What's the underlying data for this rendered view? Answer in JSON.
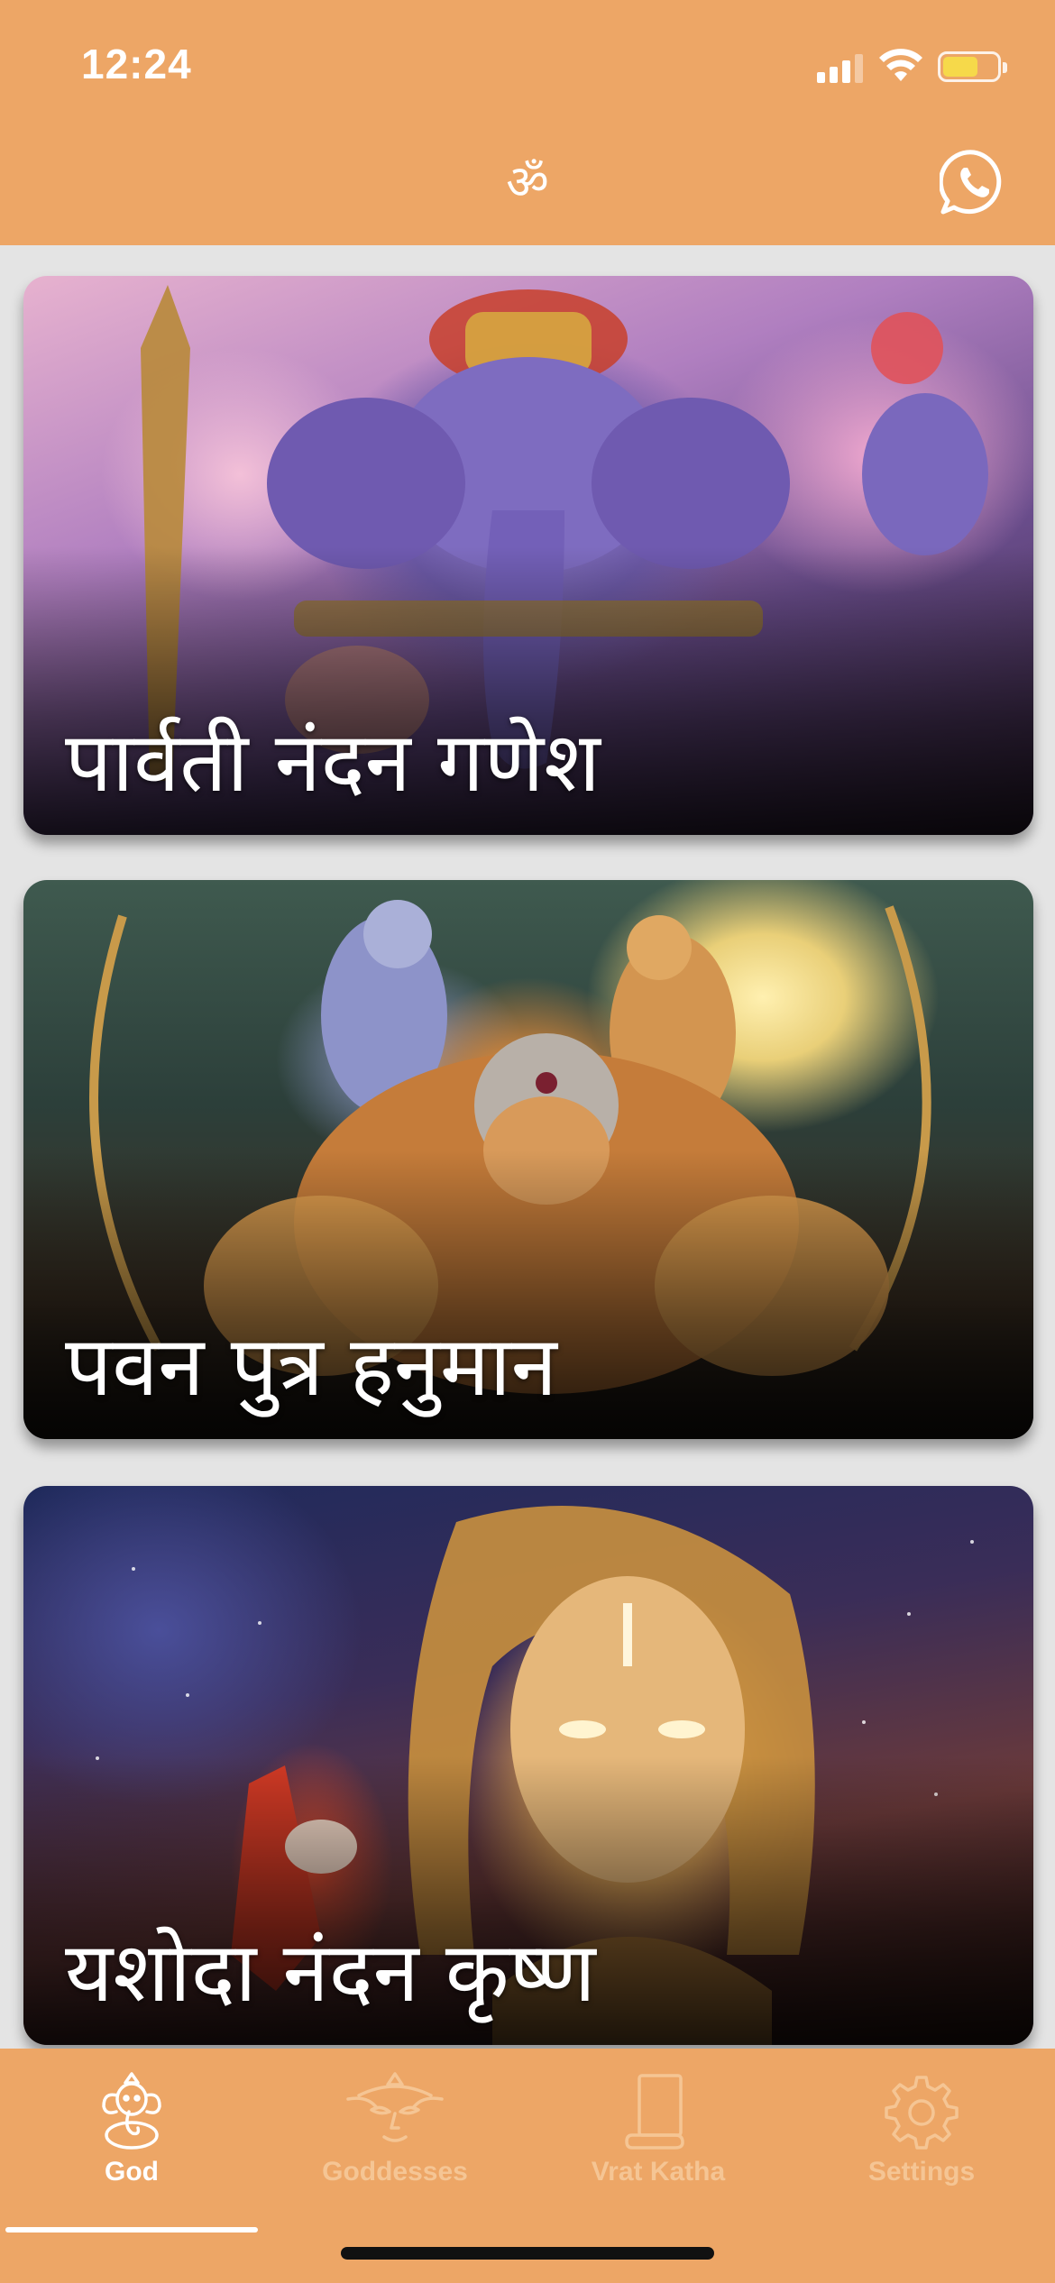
{
  "status_bar": {
    "time": "12:24",
    "icons": [
      "cellular-signal-icon",
      "wifi-icon",
      "battery-icon"
    ]
  },
  "header": {
    "logo_text": "ॐ",
    "logo_icon": "om-icon",
    "action_icon": "whatsapp-icon"
  },
  "cards": [
    {
      "title": "पार्वती नंदन गणेश",
      "image": "ganesh-artwork"
    },
    {
      "title": "पवन पुत्र हनुमान",
      "image": "hanuman-artwork"
    },
    {
      "title": "यशोदा नंदन कृष्ण",
      "image": "krishna-artwork"
    }
  ],
  "tabbar": {
    "tabs": [
      {
        "label": "God",
        "icon": "ganesha-icon",
        "active": true
      },
      {
        "label": "Goddesses",
        "icon": "goddess-face-icon",
        "active": false
      },
      {
        "label": "Vrat Katha",
        "icon": "scroll-icon",
        "active": false
      },
      {
        "label": "Settings",
        "icon": "gear-icon",
        "active": false
      }
    ]
  },
  "colors": {
    "header_bg": "#eda666",
    "tab_active": "#ffffff",
    "tab_inactive": "#f5c594",
    "battery_fill": "#f6d94a",
    "content_bg": "#e4e4e4"
  }
}
